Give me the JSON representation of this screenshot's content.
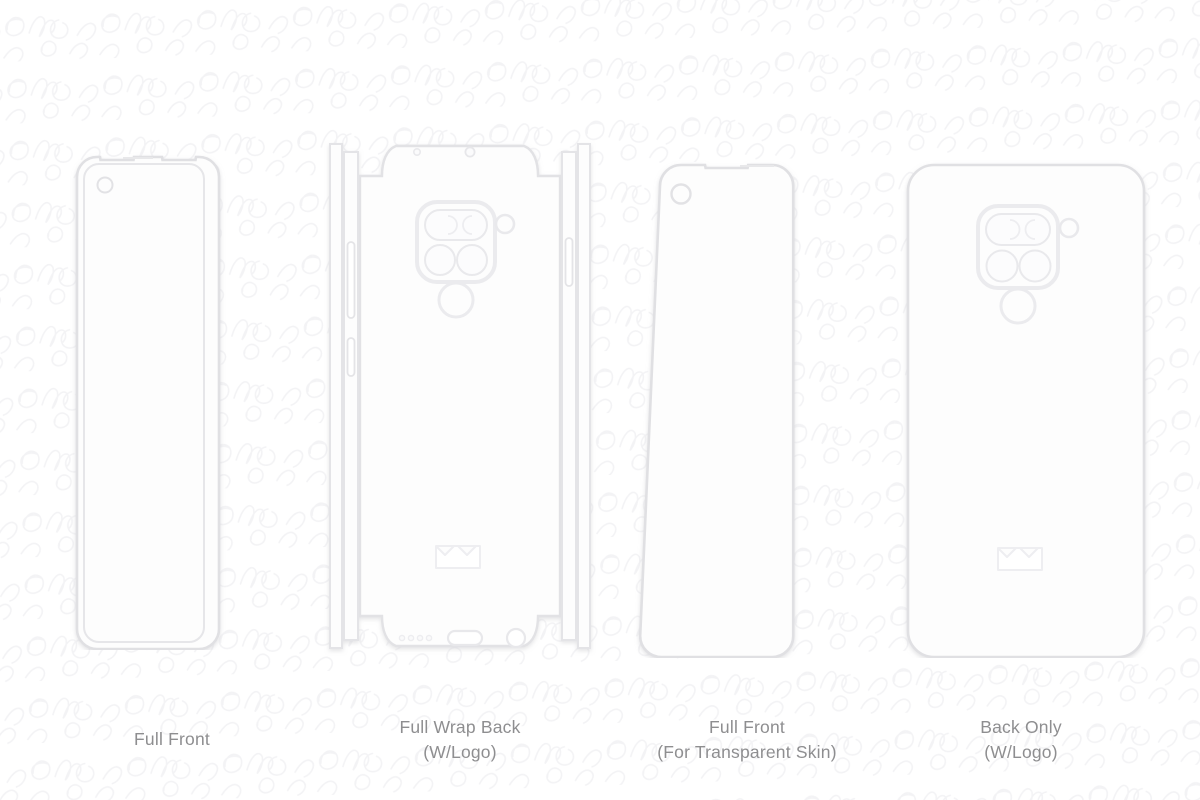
{
  "sheet": {
    "background_color": "#ffffff",
    "watermark_color": "#f6f6f7",
    "outline_color": "#e3e3e5",
    "outline_color_soft": "#eaeaec",
    "fill_color": "#fdfdfd",
    "caption_color": "#8e8e90"
  },
  "templates": [
    {
      "id": "full-front",
      "caption_lines": [
        "Full Front"
      ],
      "type": "front",
      "features": [
        "outer-shell-outline",
        "inner-screen-outline",
        "earpiece-notch",
        "punch-hole-camera"
      ]
    },
    {
      "id": "full-wrap-back-with-logo",
      "caption_lines": [
        "Full Wrap Back",
        "(W/Logo)"
      ],
      "type": "wrap-back",
      "features": [
        "top-flap",
        "bottom-flap",
        "left-side-flap",
        "right-side-flap",
        "camera-module",
        "flash",
        "fingerprint-sensor",
        "brand-logo",
        "volume-rocker",
        "power-button",
        "sim-tray",
        "speaker-grille",
        "usb-c-port",
        "headphone-jack"
      ]
    },
    {
      "id": "full-front-transparent",
      "caption_lines": [
        "Full Front",
        "(For Transparent Skin)"
      ],
      "type": "front",
      "features": [
        "outer-shell-outline",
        "earpiece-notch",
        "punch-hole-camera"
      ]
    },
    {
      "id": "back-only-with-logo",
      "caption_lines": [
        "Back Only",
        "(W/Logo)"
      ],
      "type": "back",
      "features": [
        "outer-shell-outline",
        "camera-module",
        "flash",
        "fingerprint-sensor",
        "brand-logo"
      ]
    }
  ]
}
